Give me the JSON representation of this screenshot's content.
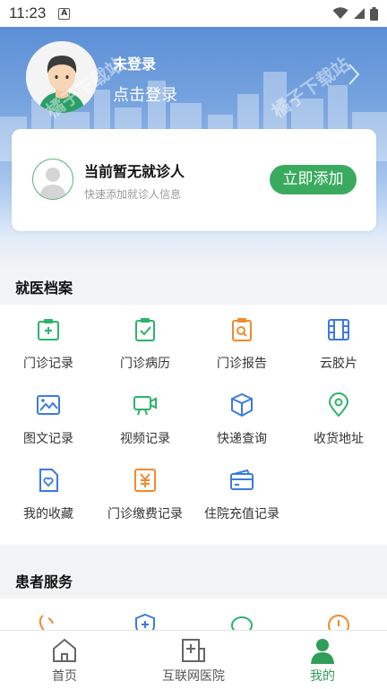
{
  "status": {
    "time": "11:23",
    "a_badge": "A"
  },
  "header": {
    "login_title": "未登录",
    "login_sub": "点击登录",
    "watermark_1": "橘子下载站",
    "watermark_2": "橘子下载站"
  },
  "patient_card": {
    "title": "当前暂无就诊人",
    "subtitle": "快速添加就诊人信息",
    "add_button": "立即添加"
  },
  "records": {
    "title": "就医档案",
    "items": [
      {
        "label": "门诊记录",
        "icon": "clipboard-plus-icon",
        "color": "#2db36a"
      },
      {
        "label": "门诊病历",
        "icon": "clipboard-check-icon",
        "color": "#2db36a"
      },
      {
        "label": "门诊报告",
        "icon": "clipboard-search-icon",
        "color": "#f08a2c"
      },
      {
        "label": "云胶片",
        "icon": "film-icon",
        "color": "#3a7be0"
      },
      {
        "label": "图文记录",
        "icon": "image-icon",
        "color": "#3a7be0"
      },
      {
        "label": "视频记录",
        "icon": "video-camera-icon",
        "color": "#2db36a"
      },
      {
        "label": "快递查询",
        "icon": "package-icon",
        "color": "#3a7be0"
      },
      {
        "label": "收货地址",
        "icon": "location-pin-icon",
        "color": "#2db36a"
      },
      {
        "label": "我的收藏",
        "icon": "heart-document-icon",
        "color": "#3a7be0"
      },
      {
        "label": "门诊缴费记录",
        "icon": "yen-receipt-icon",
        "color": "#f08a2c"
      },
      {
        "label": "住院充值记录",
        "icon": "wallet-card-icon",
        "color": "#3a7be0"
      }
    ]
  },
  "services": {
    "title": "患者服务",
    "icons": [
      "phone-icon",
      "shield-plus-icon",
      "chat-bubble-icon",
      "alert-circle-icon"
    ],
    "colors": [
      "#f08a2c",
      "#3a7be0",
      "#2db36a",
      "#f08a2c"
    ]
  },
  "nav": {
    "items": [
      {
        "label": "首页",
        "icon": "home-icon",
        "active": false
      },
      {
        "label": "互联网医院",
        "icon": "hospital-icon",
        "active": false
      },
      {
        "label": "我的",
        "icon": "user-icon",
        "active": true
      }
    ]
  }
}
